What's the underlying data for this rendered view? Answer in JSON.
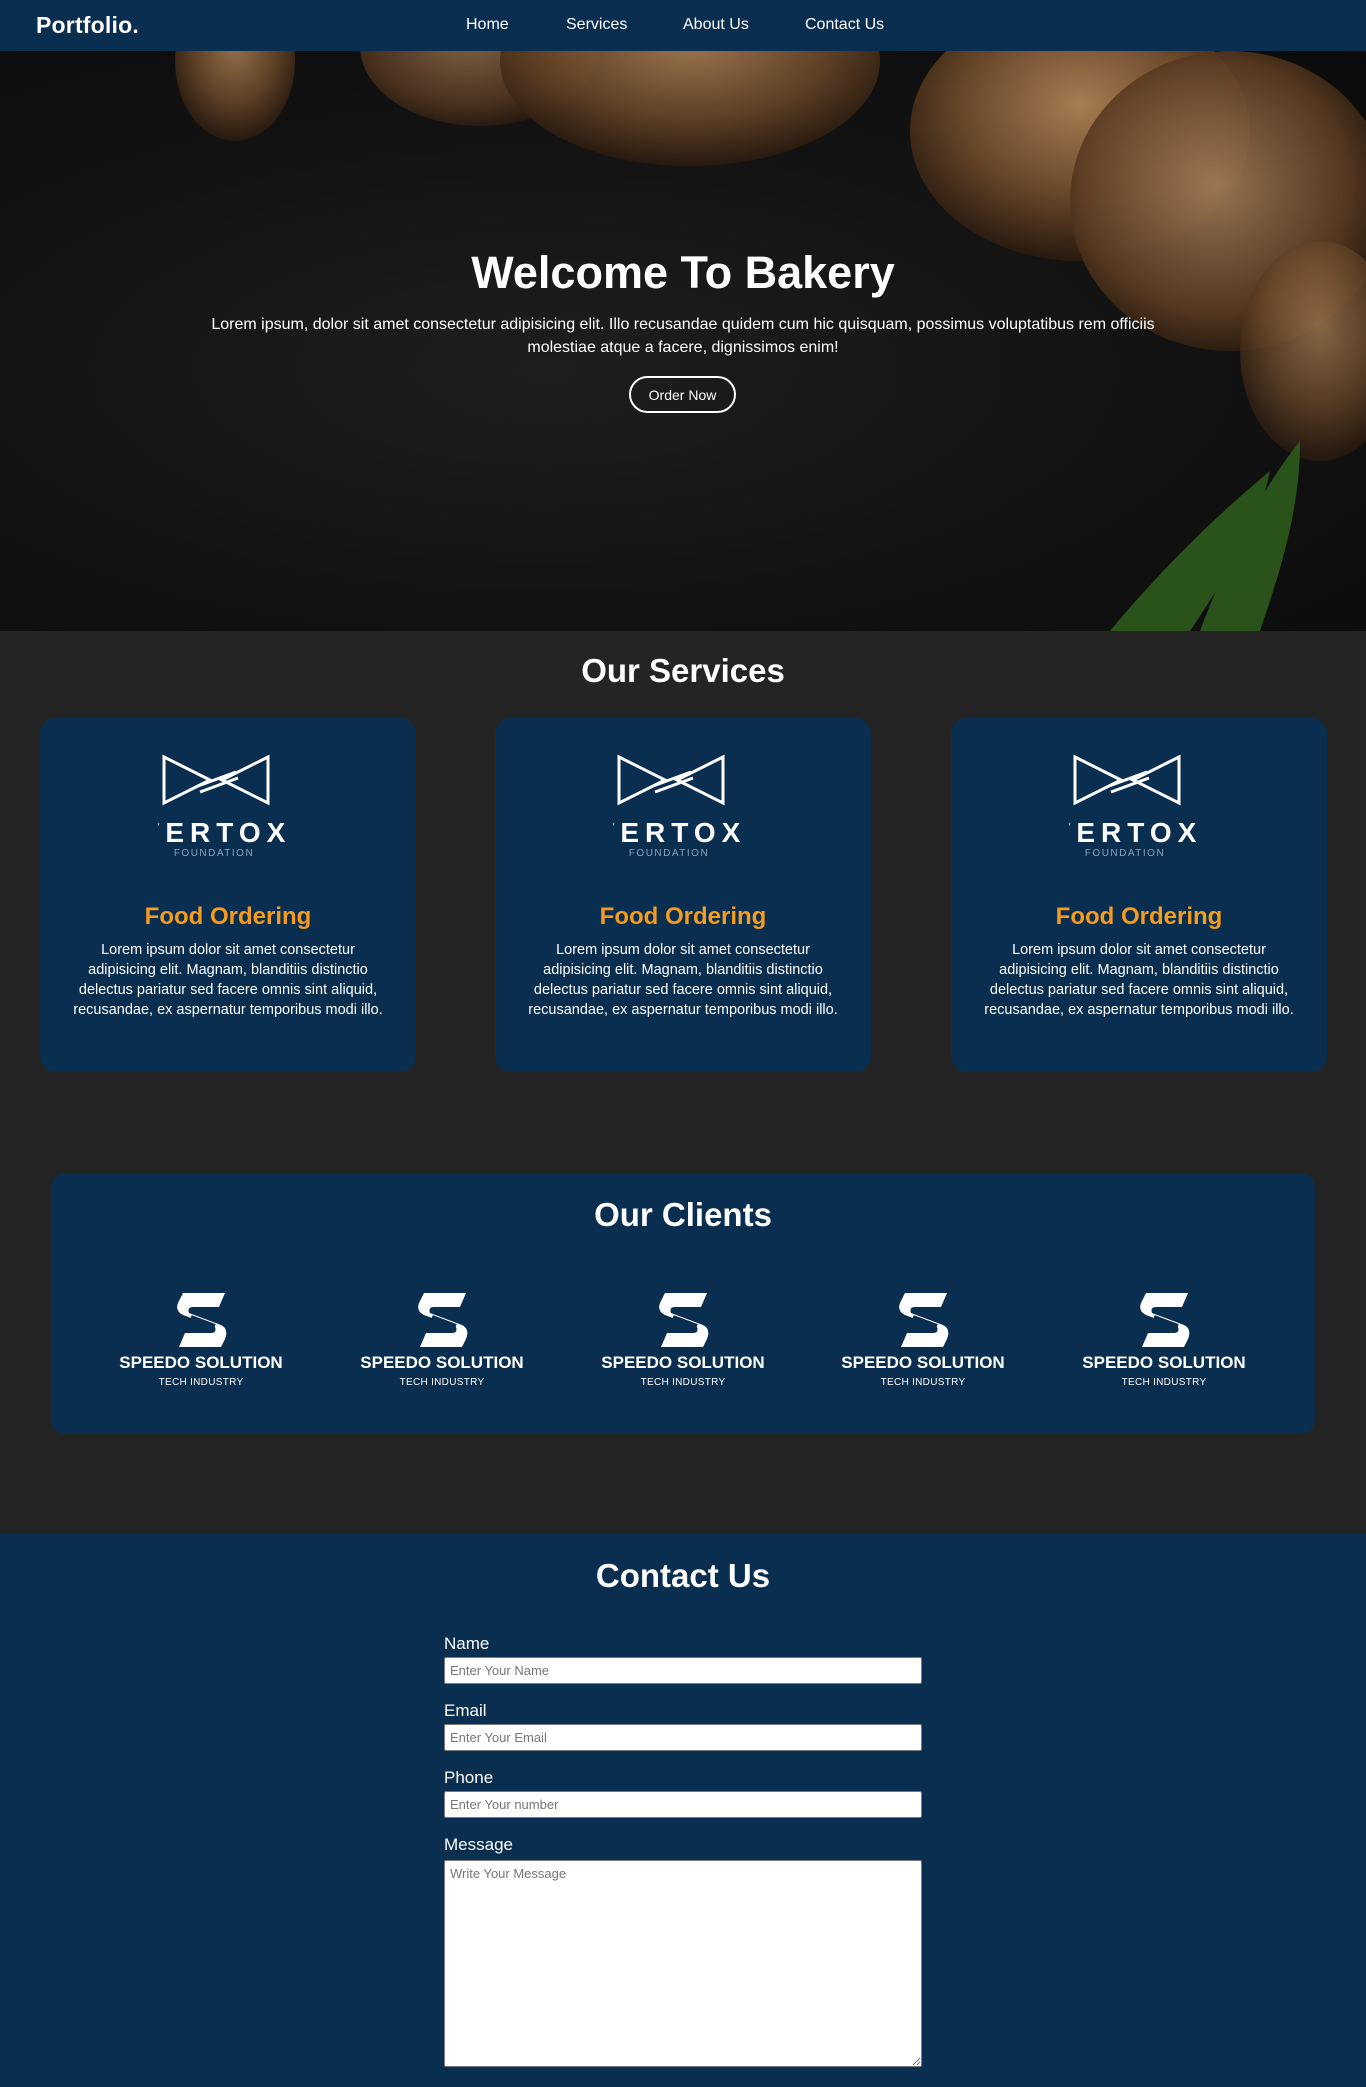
{
  "nav": {
    "brand": "Portfolio.",
    "links": [
      "Home",
      "Services",
      "About Us",
      "Contact Us"
    ]
  },
  "hero": {
    "title": "Welcome To Bakery",
    "text": "Lorem ipsum, dolor sit amet consectetur adipisicing elit. Illo recusandae quidem cum hic quisquam, possimus voluptatibus rem officiis molestiae atque a facere, dignissimos enim!",
    "button": "Order Now"
  },
  "services": {
    "title": "Our Services",
    "cards": [
      {
        "logo_name": "VERTOX",
        "logo_sub": "FOUNDATION",
        "title": "Food Ordering",
        "text": "Lorem ipsum dolor sit amet consectetur adipisicing elit. Magnam, blanditiis distinctio delectus pariatur sed facere omnis sint aliquid, recusandae, ex aspernatur temporibus modi illo."
      },
      {
        "logo_name": "VERTOX",
        "logo_sub": "FOUNDATION",
        "title": "Food Ordering",
        "text": "Lorem ipsum dolor sit amet consectetur adipisicing elit. Magnam, blanditiis distinctio delectus pariatur sed facere omnis sint aliquid, recusandae, ex aspernatur temporibus modi illo."
      },
      {
        "logo_name": "VERTOX",
        "logo_sub": "FOUNDATION",
        "title": "Food Ordering",
        "text": "Lorem ipsum dolor sit amet consectetur adipisicing elit. Magnam, blanditiis distinctio delectus pariatur sed facere omnis sint aliquid, recusandae, ex aspernatur temporibus modi illo."
      }
    ]
  },
  "clients": {
    "title": "Our Clients",
    "items": [
      {
        "name": "SPEEDO SOLUTION",
        "sub": "TECH INDUSTRY"
      },
      {
        "name": "SPEEDO SOLUTION",
        "sub": "TECH INDUSTRY"
      },
      {
        "name": "SPEEDO SOLUTION",
        "sub": "TECH INDUSTRY"
      },
      {
        "name": "SPEEDO SOLUTION",
        "sub": "TECH INDUSTRY"
      },
      {
        "name": "SPEEDO SOLUTION",
        "sub": "TECH INDUSTRY"
      }
    ]
  },
  "contact": {
    "title": "Contact Us",
    "name_label": "Name",
    "name_placeholder": "Enter Your Name",
    "email_label": "Email",
    "email_placeholder": "Enter Your Email",
    "phone_label": "Phone",
    "phone_placeholder": "Enter Your number",
    "message_label": "Message",
    "message_placeholder": "Write Your Message"
  },
  "colors": {
    "navy": "#0a2e50",
    "page_bg": "#242424",
    "accent_orange": "#f59b1e"
  },
  "icons": {
    "service_logo": "vertox-bowtie-logo-icon",
    "client_logo": "speedo-s-logo-icon"
  }
}
